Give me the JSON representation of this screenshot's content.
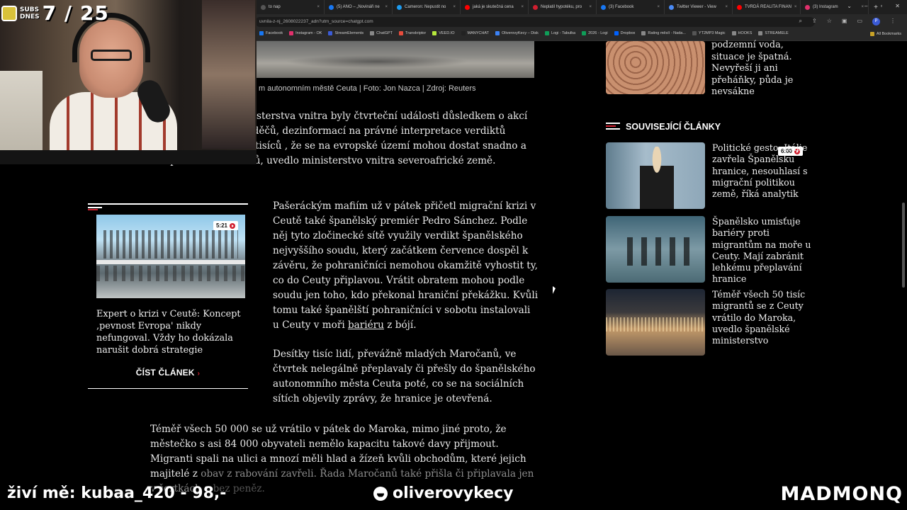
{
  "browser": {
    "tabs": [
      {
        "label": "to nap",
        "color": "#555"
      },
      {
        "label": "(5) ANO – „Novináři ne",
        "color": "#1877f2"
      },
      {
        "label": "Cameron: Nepustit no",
        "color": "#1d9bf0"
      },
      {
        "label": "jaká je skutečná cena",
        "color": "#ff0000"
      },
      {
        "label": "Neplatil hypotéku, pro",
        "color": "#d01f2f"
      },
      {
        "label": "(3) Facebook",
        "color": "#1877f2"
      },
      {
        "label": "Twitter Viewer - View",
        "color": "#4a8af4"
      },
      {
        "label": "TVRDÁ REALITA FINAN",
        "color": "#ff0000"
      },
      {
        "label": "(3) Instagram",
        "color": "#e1306c"
      }
    ],
    "url": "uvnila-z-nj_2608022237_adn?utm_source=chatgpt.com",
    "bookmarks": [
      {
        "label": "Facebook",
        "color": "#1877f2"
      },
      {
        "label": "Instagram - OK",
        "color": "#e1306c"
      },
      {
        "label": "StreamElements",
        "color": "#3b5bd6"
      },
      {
        "label": "ChatGPT",
        "color": "#888"
      },
      {
        "label": "Transkriptor",
        "color": "#e74c3c"
      },
      {
        "label": "VEED.IO",
        "color": "#b6e83c"
      },
      {
        "label": "MANYCHAT",
        "color": "#222"
      },
      {
        "label": "OliverovyKecy – Disk",
        "color": "#3b82f6"
      },
      {
        "label": "Logi - Tabulka",
        "color": "#0f9d58"
      },
      {
        "label": "2026 - Logi",
        "color": "#0f9d58"
      },
      {
        "label": "Dropbox",
        "color": "#0061fe"
      },
      {
        "label": "Rating měsíí - Nada...",
        "color": "#888"
      },
      {
        "label": "YT2MP3 Magic",
        "color": "#555"
      },
      {
        "label": "HOOKS",
        "color": "#888"
      },
      {
        "label": "STREAMELE",
        "color": "#888"
      }
    ],
    "all_bookmarks": "All Bookmarks",
    "profile_initial": "P"
  },
  "article": {
    "caption": "m autonomním městě Ceuta | Foto: Jon Nazca | Zdroj: Reuters",
    "p1": "sterstva vnitra byly čtvrteční události důsledkem o akcí sítí pašeráků a převaděčů, dezinformací na právné interpretace verdiktů soudu. To vytvořilo u tisíců , že se na evropské území mohou dostat snadno a bez právních důsledků, uvedlo ministerstvo vnitra severoafrické země.",
    "p2_before": "Pašeráckým mafiím už v pátek přičetl migrační krizi v Ceutě také španělský premiér Pedro Sánchez. Podle něj tyto zločinecké sítě využily verdikt španělského nejvyššího soudu, který začátkem července dospěl k závěru, že pohraničníci nemohou okamžitě vyhostit ty, co do Ceuty připlavou. Vrátit obratem mohou podle soudu jen toho, kdo překonal hraniční překážku. Kvůli tomu také španělští pohraničníci v sobotu instalovali u Ceuty v moři ",
    "p2_link": "bariéru",
    "p2_after": " z bójí.",
    "p3": "Desítky tisíc lidí, převážně mladých Maročanů, ve čtvrtek nelegálně přeplavaly či přešly do španělského autonomního města Ceuta poté, co se na sociálních sítích objevily zprávy, že hranice je otevřená.",
    "p4_a": "Téměř všech 50 000 se už vrátilo v pátek do Maroka, mimo jiné proto, že městečko s asi 84 000 obyvateli nemělo kapacitu takové davy přijmout. Migranti spali na ulici a mnozí měli hlad a žízeň kvůli obchodům, které jejich majitelé z",
    "p4_b": " obav z rabování zavřeli. Řada Maročanů také přišla či připlavala jen v šortkách a",
    "p4_c": " bez peněz."
  },
  "side_card": {
    "duration": "5:21",
    "title": "Expert o krizi v Ceutě: Koncept ‚pevnost Evropa' nikdy nefungoval. Vždy ho dokázala narušit dobrá strategie",
    "cta": "ČÍST ČLÁNEK"
  },
  "right_column": {
    "top_text": "podzemní voda, situace je špatná. Nevyřeší ji ani přeháňky, půda je nevsákne",
    "related_heading": "SOUVISEJÍCÍ ČLÁNKY",
    "related": [
      {
        "title": "Politické gesto. Itálie zavřela Španělsku hranice, nesouhlasí s migrační politikou země, říká analytik",
        "duration": "6:00"
      },
      {
        "title": "Španělsko umisťuje bariéry proti migrantům na moře u Ceuty. Mají zabránit lehkému přeplavání hranice"
      },
      {
        "title": "Téměř všech 50 tisíc migrantů se z Ceuty vrátilo do Maroka, uvedlo španělské ministerstvo"
      }
    ]
  },
  "stream_overlay": {
    "subs_label_1": "SUBS",
    "subs_label_2": "DNES",
    "subs_count": "7 / 25",
    "donor": "živí mě: kubaa_420 - 98,-",
    "handle": "oliverovykecy",
    "brand": "MADMONQ"
  },
  "colors": {
    "accent": "#d01f2f",
    "background": "#000000"
  }
}
